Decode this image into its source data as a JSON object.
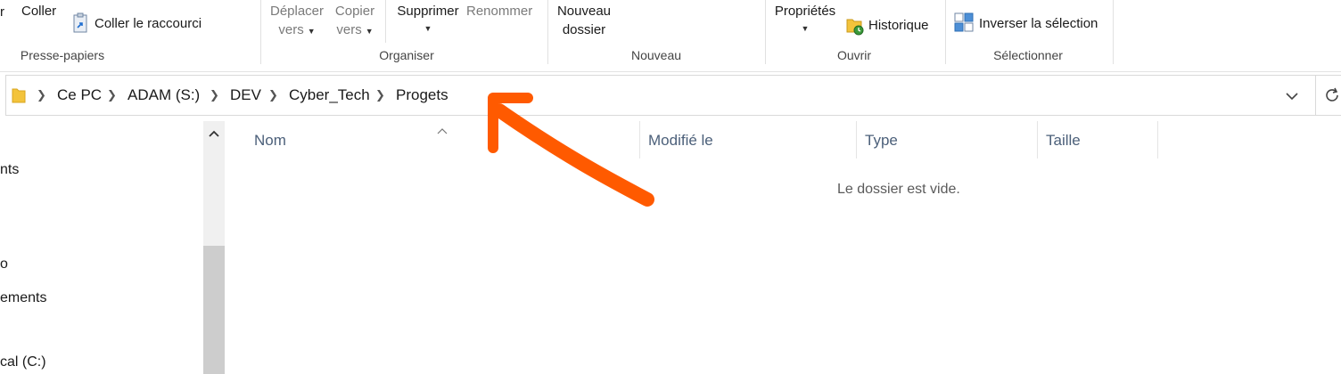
{
  "ribbon": {
    "clipboard": {
      "group_label": "Presse-papiers",
      "paste_label": "Coller",
      "paste_shortcut_label": "Coller le raccourci"
    },
    "organize": {
      "group_label": "Organiser",
      "move_to_line1": "Déplacer",
      "move_to_line2": "vers",
      "copy_to_line1": "Copier",
      "copy_to_line2": "vers",
      "delete_label": "Supprimer",
      "rename_label": "Renommer"
    },
    "new": {
      "group_label": "Nouveau",
      "new_folder_line1": "Nouveau",
      "new_folder_line2": "dossier"
    },
    "open": {
      "group_label": "Ouvrir",
      "properties_label": "Propriétés",
      "history_label": "Historique"
    },
    "select": {
      "group_label": "Sélectionner",
      "invert_selection_label": "Inverser la sélection"
    }
  },
  "address_bar": {
    "crumbs": [
      "Ce PC",
      "ADAM (S:)",
      "DEV",
      "Cyber_Tech",
      "Progets"
    ]
  },
  "nav": {
    "items": [
      "nts",
      "o",
      "ements",
      "cal (C:)"
    ]
  },
  "content": {
    "columns": [
      "Nom",
      "Modifié le",
      "Type",
      "Taille"
    ],
    "empty_message": "Le dossier est vide."
  },
  "annotation": {
    "arrow_color": "#ff5a00"
  },
  "colors": {
    "accent_folder": "#f3c33b",
    "column_header_text": "#4c607a"
  }
}
